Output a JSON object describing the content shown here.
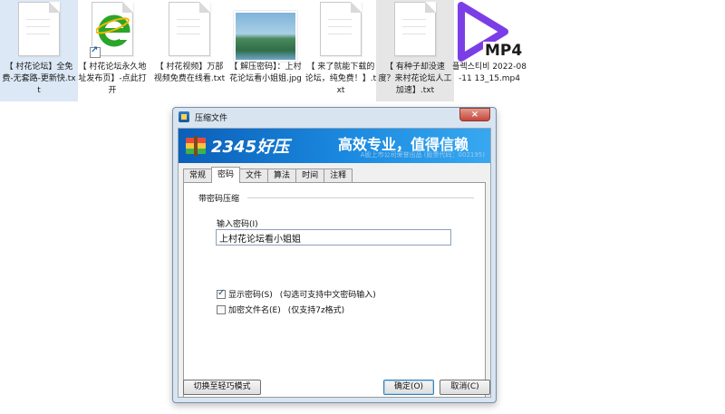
{
  "desktop": {
    "files": [
      {
        "label": "【 村花论坛】全免费-无套路-更新快.txt",
        "icon": "text-file-icon"
      },
      {
        "label": "【 村花论坛永久地址发布页】-点此打开",
        "icon": "ie-shortcut-icon"
      },
      {
        "label": "【 村花视频】万部视频免费在线看.txt",
        "icon": "text-file-icon"
      },
      {
        "label": "【 解压密码】：上村花论坛看小姐姐.jpg",
        "icon": "image-file-icon"
      },
      {
        "label": "【 来了就能下载的论坛，纯免费！】.txt",
        "icon": "text-file-icon"
      },
      {
        "label": "【 有种子却没速度？来村花论坛人工加速】.txt",
        "icon": "text-file-icon"
      },
      {
        "label": "플렉스티비 2022-08-11 13_15.mp4",
        "icon": "mp4-play-icon",
        "badge": "MP4"
      }
    ]
  },
  "dialog": {
    "title": "压缩文件",
    "close_label": "×",
    "banner": {
      "brand": "2345好压",
      "slogan": "高效专业，值得信赖",
      "subtext": "A股上市公司荣誉出品 (股票代码：002195)"
    },
    "tabs": [
      "常规",
      "密码",
      "文件",
      "算法",
      "时间",
      "注释"
    ],
    "active_tab": "密码",
    "password_tab": {
      "group_title": "带密码压缩",
      "password_label": "输入密码(I)",
      "password_value": "上村花论坛看小姐姐",
      "show_password_label": "显示密码(S)",
      "show_password_hint": "(勾选可支持中文密码输入)",
      "show_password_checked": true,
      "encrypt_names_label": "加密文件名(E)",
      "encrypt_names_hint": "(仅支持7z格式)",
      "encrypt_names_checked": false
    },
    "buttons": {
      "switch_mode": "切换至轻巧模式",
      "ok": "确定(O)",
      "cancel": "取消(C)"
    }
  },
  "colors": {
    "banner_start": "#0b5fb8",
    "banner_end": "#37a8f0",
    "mp4_purple": "#7b3ee6",
    "selection_blue": "#dce8f5"
  }
}
